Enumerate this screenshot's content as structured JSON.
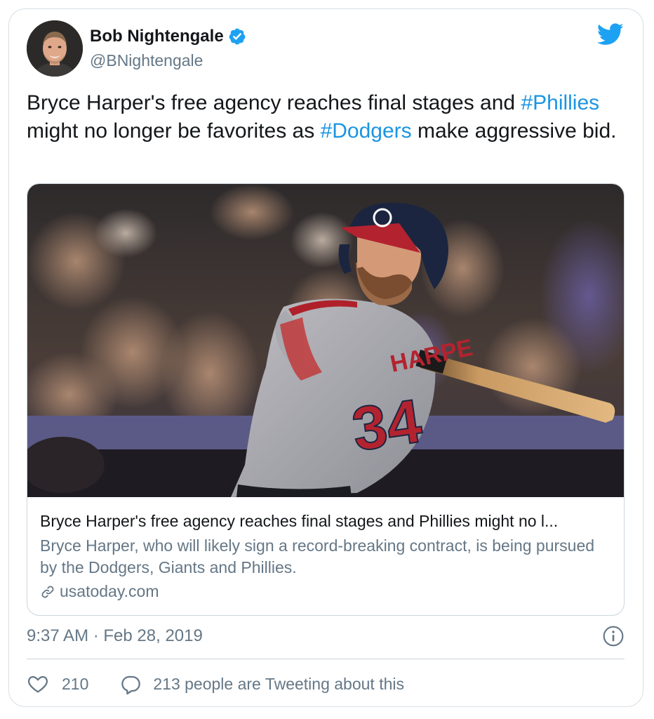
{
  "author": {
    "name": "Bob Nightengale",
    "handle": "@BNightengale"
  },
  "tweet": {
    "text_part1": "Bryce Harper's free agency reaches final stages and ",
    "hashtag1": "#Phillies",
    "text_part2": " might no longer be favorites as ",
    "hashtag2": "#Dodgers",
    "text_part3": " make aggressive bid."
  },
  "link_card": {
    "title": "Bryce Harper's free agency reaches final stages and Phillies might no l...",
    "description": "Bryce Harper, who will likely sign a record-breaking contract, is being pursued by the Dodgers, Giants and Phillies.",
    "domain": "usatoday.com",
    "jersey_name": "HARPE",
    "jersey_number": "34"
  },
  "meta": {
    "timestamp": "9:37 AM · Feb 28, 2019"
  },
  "actions": {
    "like_count": "210",
    "reply_text": "213 people are Tweeting about this"
  },
  "colors": {
    "link_blue": "#1b95e0",
    "secondary_text": "#657786",
    "twitter_blue": "#1da1f2",
    "border": "#ccd6dd"
  },
  "icons": [
    "verified-badge-icon",
    "twitter-bird-icon",
    "link-icon",
    "info-icon",
    "heart-icon",
    "reply-bubble-icon"
  ]
}
